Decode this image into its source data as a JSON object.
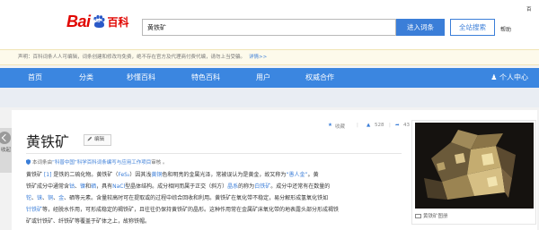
{
  "header": {
    "logo_text_bai": "Bai",
    "logo_text_du": "du",
    "logo_text_baike": "百科",
    "search_value": "黄铁矿",
    "enter_button": "进入词条",
    "search_all_button": "全站搜索",
    "help_link": "帮助",
    "top_right_snippet": "百"
  },
  "notice": {
    "text": "声明：百科词条人人可编辑，词条创建和修改均免费，绝不存在官方及代理商付费代编，请勿上当受骗。",
    "more_link": "详情>>"
  },
  "nav": {
    "items": [
      "首页",
      "分类",
      "秒懂百科",
      "特色百科",
      "用户",
      "权威合作"
    ],
    "user_center": "个人中心"
  },
  "sidetab": {
    "label": "收起"
  },
  "article": {
    "title": "黄铁矿",
    "edit_label": "编辑",
    "actions": {
      "collect": "收藏",
      "likes": "528",
      "shares": "43"
    },
    "source": {
      "prefix": "本词条由",
      "org": "“科普中国”科学百科词条编写与应用工作项目",
      "suffix": "审核 。"
    },
    "paragraph": [
      {
        "segments": [
          {
            "t": "黄铁矿",
            "link": false
          },
          {
            "t": " [1] ",
            "link": true
          },
          {
            "t": "是铁的二硫化物。黄铁矿（",
            "link": false
          },
          {
            "t": "FeS₂",
            "link": true
          },
          {
            "t": "）因其浅",
            "link": false
          },
          {
            "t": "黄铜",
            "link": true
          },
          {
            "t": "色和明亮的金属光泽，常被误认为是黄金，故又称为",
            "link": false
          },
          {
            "t": "“愚人金”",
            "link": true
          },
          {
            "t": "。黄",
            "link": false
          }
        ]
      },
      {
        "segments": [
          {
            "t": "铁矿成分中通常含",
            "link": false
          },
          {
            "t": "钴",
            "link": true
          },
          {
            "t": "、",
            "link": false
          },
          {
            "t": "镍",
            "link": true
          },
          {
            "t": "和",
            "link": false
          },
          {
            "t": "硒",
            "link": true
          },
          {
            "t": "，具有",
            "link": false
          },
          {
            "t": "NaCl",
            "link": true
          },
          {
            "t": "型晶体结构。成分相同而属于正交（斜方）",
            "link": false
          },
          {
            "t": "晶系",
            "link": true
          },
          {
            "t": "的称为",
            "link": false
          },
          {
            "t": "白铁矿",
            "link": true
          },
          {
            "t": "。成分中还常有在数量的",
            "link": false
          }
        ]
      },
      {
        "segments": [
          {
            "t": "铊",
            "link": true
          },
          {
            "t": "、",
            "link": false
          },
          {
            "t": "铼",
            "link": true
          },
          {
            "t": "、",
            "link": false
          },
          {
            "t": "铜",
            "link": true
          },
          {
            "t": "、",
            "link": false
          },
          {
            "t": "金",
            "link": true
          },
          {
            "t": "、硒等元素。含量较高时可在提取或的过程中综合回收和利用。黄铁矿在氧化带不稳定，易分解形成氢氧化铁如",
            "link": false
          }
        ]
      },
      {
        "segments": [
          {
            "t": "针铁矿",
            "link": true
          },
          {
            "t": "等，经脱水作用，可形成稳定的褐铁矿，且往往仍保持黄铁矿的晶形。这种作用常在金属矿床氧化带的地表露头部分形成褐铁",
            "link": false
          }
        ]
      },
      {
        "segments": [
          {
            "t": "矿或针铁矿、纤铁矿等覆盖于矿体之上，故称铁帽。",
            "link": false
          }
        ]
      }
    ]
  },
  "sidebar": {
    "photo_caption": "黄铁矿图册"
  },
  "colors": {
    "brand_red": "#e10602",
    "nav_blue": "#3b86e0",
    "link_blue": "#3b7ed8"
  }
}
